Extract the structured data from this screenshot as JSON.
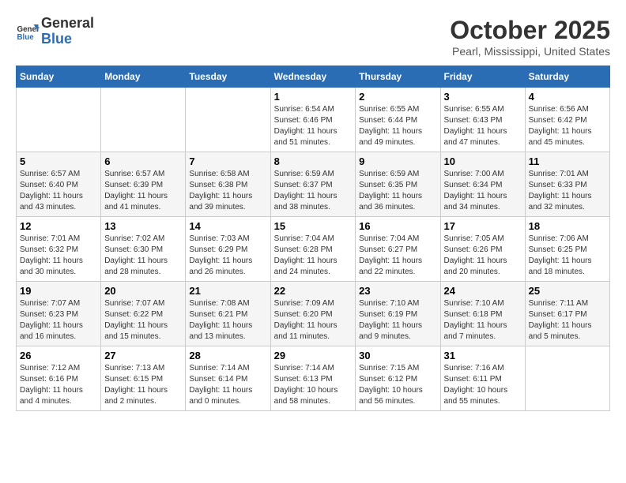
{
  "header": {
    "logo_line1": "General",
    "logo_line2": "Blue",
    "month_title": "October 2025",
    "location": "Pearl, Mississippi, United States"
  },
  "weekdays": [
    "Sunday",
    "Monday",
    "Tuesday",
    "Wednesday",
    "Thursday",
    "Friday",
    "Saturday"
  ],
  "weeks": [
    [
      {
        "day": "",
        "info": ""
      },
      {
        "day": "",
        "info": ""
      },
      {
        "day": "",
        "info": ""
      },
      {
        "day": "1",
        "info": "Sunrise: 6:54 AM\nSunset: 6:46 PM\nDaylight: 11 hours\nand 51 minutes."
      },
      {
        "day": "2",
        "info": "Sunrise: 6:55 AM\nSunset: 6:44 PM\nDaylight: 11 hours\nand 49 minutes."
      },
      {
        "day": "3",
        "info": "Sunrise: 6:55 AM\nSunset: 6:43 PM\nDaylight: 11 hours\nand 47 minutes."
      },
      {
        "day": "4",
        "info": "Sunrise: 6:56 AM\nSunset: 6:42 PM\nDaylight: 11 hours\nand 45 minutes."
      }
    ],
    [
      {
        "day": "5",
        "info": "Sunrise: 6:57 AM\nSunset: 6:40 PM\nDaylight: 11 hours\nand 43 minutes."
      },
      {
        "day": "6",
        "info": "Sunrise: 6:57 AM\nSunset: 6:39 PM\nDaylight: 11 hours\nand 41 minutes."
      },
      {
        "day": "7",
        "info": "Sunrise: 6:58 AM\nSunset: 6:38 PM\nDaylight: 11 hours\nand 39 minutes."
      },
      {
        "day": "8",
        "info": "Sunrise: 6:59 AM\nSunset: 6:37 PM\nDaylight: 11 hours\nand 38 minutes."
      },
      {
        "day": "9",
        "info": "Sunrise: 6:59 AM\nSunset: 6:35 PM\nDaylight: 11 hours\nand 36 minutes."
      },
      {
        "day": "10",
        "info": "Sunrise: 7:00 AM\nSunset: 6:34 PM\nDaylight: 11 hours\nand 34 minutes."
      },
      {
        "day": "11",
        "info": "Sunrise: 7:01 AM\nSunset: 6:33 PM\nDaylight: 11 hours\nand 32 minutes."
      }
    ],
    [
      {
        "day": "12",
        "info": "Sunrise: 7:01 AM\nSunset: 6:32 PM\nDaylight: 11 hours\nand 30 minutes."
      },
      {
        "day": "13",
        "info": "Sunrise: 7:02 AM\nSunset: 6:30 PM\nDaylight: 11 hours\nand 28 minutes."
      },
      {
        "day": "14",
        "info": "Sunrise: 7:03 AM\nSunset: 6:29 PM\nDaylight: 11 hours\nand 26 minutes."
      },
      {
        "day": "15",
        "info": "Sunrise: 7:04 AM\nSunset: 6:28 PM\nDaylight: 11 hours\nand 24 minutes."
      },
      {
        "day": "16",
        "info": "Sunrise: 7:04 AM\nSunset: 6:27 PM\nDaylight: 11 hours\nand 22 minutes."
      },
      {
        "day": "17",
        "info": "Sunrise: 7:05 AM\nSunset: 6:26 PM\nDaylight: 11 hours\nand 20 minutes."
      },
      {
        "day": "18",
        "info": "Sunrise: 7:06 AM\nSunset: 6:25 PM\nDaylight: 11 hours\nand 18 minutes."
      }
    ],
    [
      {
        "day": "19",
        "info": "Sunrise: 7:07 AM\nSunset: 6:23 PM\nDaylight: 11 hours\nand 16 minutes."
      },
      {
        "day": "20",
        "info": "Sunrise: 7:07 AM\nSunset: 6:22 PM\nDaylight: 11 hours\nand 15 minutes."
      },
      {
        "day": "21",
        "info": "Sunrise: 7:08 AM\nSunset: 6:21 PM\nDaylight: 11 hours\nand 13 minutes."
      },
      {
        "day": "22",
        "info": "Sunrise: 7:09 AM\nSunset: 6:20 PM\nDaylight: 11 hours\nand 11 minutes."
      },
      {
        "day": "23",
        "info": "Sunrise: 7:10 AM\nSunset: 6:19 PM\nDaylight: 11 hours\nand 9 minutes."
      },
      {
        "day": "24",
        "info": "Sunrise: 7:10 AM\nSunset: 6:18 PM\nDaylight: 11 hours\nand 7 minutes."
      },
      {
        "day": "25",
        "info": "Sunrise: 7:11 AM\nSunset: 6:17 PM\nDaylight: 11 hours\nand 5 minutes."
      }
    ],
    [
      {
        "day": "26",
        "info": "Sunrise: 7:12 AM\nSunset: 6:16 PM\nDaylight: 11 hours\nand 4 minutes."
      },
      {
        "day": "27",
        "info": "Sunrise: 7:13 AM\nSunset: 6:15 PM\nDaylight: 11 hours\nand 2 minutes."
      },
      {
        "day": "28",
        "info": "Sunrise: 7:14 AM\nSunset: 6:14 PM\nDaylight: 11 hours\nand 0 minutes."
      },
      {
        "day": "29",
        "info": "Sunrise: 7:14 AM\nSunset: 6:13 PM\nDaylight: 10 hours\nand 58 minutes."
      },
      {
        "day": "30",
        "info": "Sunrise: 7:15 AM\nSunset: 6:12 PM\nDaylight: 10 hours\nand 56 minutes."
      },
      {
        "day": "31",
        "info": "Sunrise: 7:16 AM\nSunset: 6:11 PM\nDaylight: 10 hours\nand 55 minutes."
      },
      {
        "day": "",
        "info": ""
      }
    ]
  ]
}
